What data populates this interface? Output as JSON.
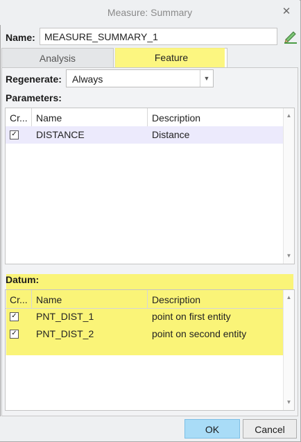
{
  "window": {
    "title": "Measure: Summary"
  },
  "name": {
    "label": "Name:",
    "value": "MEASURE_SUMMARY_1"
  },
  "tabs": [
    {
      "label": "Analysis"
    },
    {
      "label": "Feature"
    }
  ],
  "regenerate": {
    "label": "Regenerate:",
    "value": "Always"
  },
  "parameters": {
    "label": "Parameters:",
    "columns": [
      "Cr...",
      "Name",
      "Description"
    ],
    "rows": [
      {
        "checked": true,
        "name": "DISTANCE",
        "description": "Distance"
      }
    ]
  },
  "datum": {
    "label": "Datum:",
    "columns": [
      "Cr...",
      "Name",
      "Description"
    ],
    "rows": [
      {
        "checked": true,
        "name": "PNT_DIST_1",
        "description": "point on first entity"
      },
      {
        "checked": true,
        "name": "PNT_DIST_2",
        "description": "point on second entity"
      }
    ]
  },
  "buttons": {
    "ok": "OK",
    "cancel": "Cancel"
  },
  "colors": {
    "highlight": "#fbf46a",
    "ok_button": "#a9dcf7",
    "selected_row": "#eceafc"
  }
}
